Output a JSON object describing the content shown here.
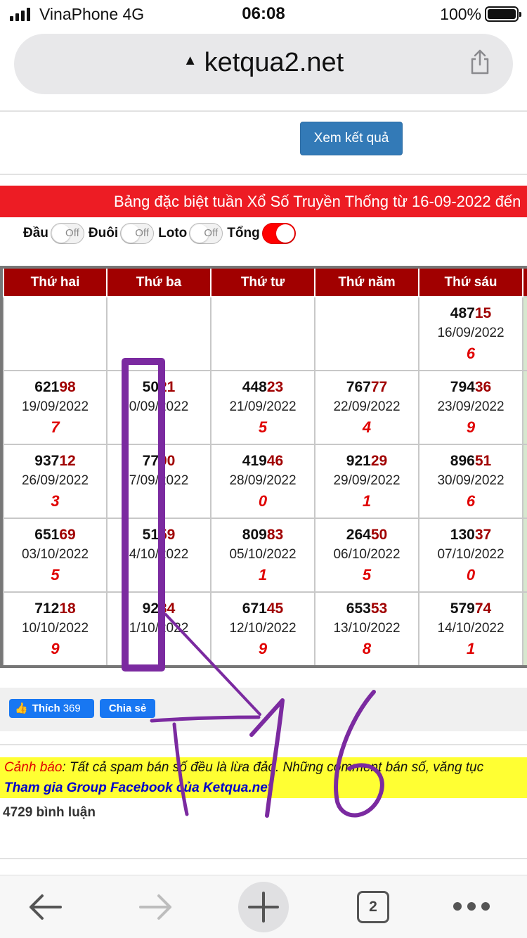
{
  "status_bar": {
    "carrier": "VinaPhone  4G",
    "time": "06:08",
    "battery_pct": "100%"
  },
  "browser": {
    "url": "ketqua2.net"
  },
  "view_button": "Xem kết quả",
  "banner": "Bảng đặc biệt tuần Xổ Số Truyền Thống từ 16-09-2022 đến",
  "toggles": {
    "dau": "Đầu",
    "duoi": "Đuôi",
    "loto": "Loto",
    "tong": "Tổng",
    "off_label": "Off"
  },
  "table": {
    "headers": [
      "Thứ hai",
      "Thứ ba",
      "Thứ tư",
      "Thứ năm",
      "Thứ sáu"
    ],
    "rows": [
      [
        {
          "head": "",
          "tail": "",
          "date": "",
          "sum": ""
        },
        {
          "head": "",
          "tail": "",
          "date": "",
          "sum": ""
        },
        {
          "head": "",
          "tail": "",
          "date": "",
          "sum": ""
        },
        {
          "head": "",
          "tail": "",
          "date": "",
          "sum": ""
        },
        {
          "head": "487",
          "tail": "15",
          "date": "16/09/2022",
          "sum": "6"
        }
      ],
      [
        {
          "head": "621",
          "tail": "98",
          "date": "19/09/2022",
          "sum": "7"
        },
        {
          "head": "50",
          "tail": "21",
          "date": "0/09/2022",
          "sum": ""
        },
        {
          "head": "448",
          "tail": "23",
          "date": "21/09/2022",
          "sum": "5"
        },
        {
          "head": "767",
          "tail": "77",
          "date": "22/09/2022",
          "sum": "4"
        },
        {
          "head": "794",
          "tail": "36",
          "date": "23/09/2022",
          "sum": "9"
        }
      ],
      [
        {
          "head": "937",
          "tail": "12",
          "date": "26/09/2022",
          "sum": "3"
        },
        {
          "head": "77",
          "tail": "90",
          "date": "7/09/2022",
          "sum": ""
        },
        {
          "head": "419",
          "tail": "46",
          "date": "28/09/2022",
          "sum": "0"
        },
        {
          "head": "921",
          "tail": "29",
          "date": "29/09/2022",
          "sum": "1"
        },
        {
          "head": "896",
          "tail": "51",
          "date": "30/09/2022",
          "sum": "6"
        }
      ],
      [
        {
          "head": "651",
          "tail": "69",
          "date": "03/10/2022",
          "sum": "5"
        },
        {
          "head": "51",
          "tail": "59",
          "date": "4/10/2022",
          "sum": ""
        },
        {
          "head": "809",
          "tail": "83",
          "date": "05/10/2022",
          "sum": "1"
        },
        {
          "head": "264",
          "tail": "50",
          "date": "06/10/2022",
          "sum": "5"
        },
        {
          "head": "130",
          "tail": "37",
          "date": "07/10/2022",
          "sum": "0"
        }
      ],
      [
        {
          "head": "712",
          "tail": "18",
          "date": "10/10/2022",
          "sum": "9"
        },
        {
          "head": "92",
          "tail": "34",
          "date": "1/10/2022",
          "sum": ""
        },
        {
          "head": "671",
          "tail": "45",
          "date": "12/10/2022",
          "sum": "9"
        },
        {
          "head": "653",
          "tail": "53",
          "date": "13/10/2022",
          "sum": "8"
        },
        {
          "head": "579",
          "tail": "74",
          "date": "14/10/2022",
          "sum": "1"
        }
      ]
    ]
  },
  "social": {
    "like_label": "Thích",
    "like_count": "369",
    "share_label": "Chia sẻ"
  },
  "warning": {
    "label": "Cảnh báo",
    "body": ": Tất cả spam bán số đều là lừa đảo. Những comment bán số, văng tục",
    "group_link": "Tham gia Group Facebook của Ketqua.net"
  },
  "comments": "4729 bình luận",
  "toolbar": {
    "tab_count": "2"
  },
  "colors": {
    "banner": "#ed1c24",
    "header": "#a10000",
    "accent_red": "#e00000",
    "button_blue": "#337ab7",
    "annotation": "#7b2aa0"
  }
}
